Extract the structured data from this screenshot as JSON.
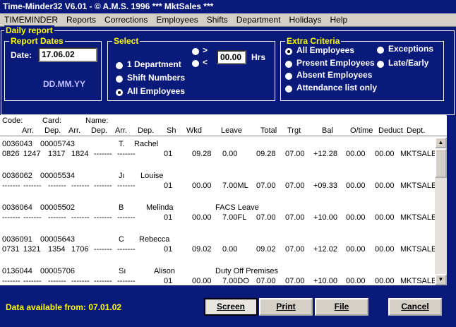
{
  "window": {
    "title": "Time-Minder32 V6.01 - © A.M.S. 1996   *** MktSales ***"
  },
  "menu": [
    "TIMEMINDER",
    "Reports",
    "Corrections",
    "Employees",
    "Shifts",
    "Department",
    "Holidays",
    "Help"
  ],
  "daily_report": {
    "label": "Daily report"
  },
  "report_dates": {
    "label": "Report Dates",
    "date_label": "Date:",
    "date_value": "17.06.02",
    "format_hint": "DD.MM.YY"
  },
  "select": {
    "label": "Select",
    "options": [
      "1 Department",
      "Shift Numbers",
      "All Employees"
    ],
    "selected": "All Employees",
    "compare_gt": ">",
    "compare_lt": "<",
    "hours_value": "00.00",
    "hours_unit": "Hrs"
  },
  "extra": {
    "label": "Extra Criteria",
    "options": [
      "All Employees",
      "Present Employees",
      "Absent Employees",
      "Attendance list only",
      "Exceptions",
      "Late/Early"
    ],
    "selected": "All Employees"
  },
  "columns": {
    "line1": [
      "Code:",
      "Card:",
      "Name:"
    ],
    "line2": [
      "Arr.",
      "Dep.",
      "Arr.",
      "Dep.",
      "Arr.",
      "Dep.",
      "Sh",
      "Wkd",
      "Leave",
      "Total",
      "Trgt",
      "Bal",
      "O/time",
      "Deduct",
      "Dept."
    ]
  },
  "rows": [
    {
      "code": "0036043",
      "card": "00005743",
      "initial": "T.",
      "name": "Rachel",
      "note": "",
      "times": [
        "0826",
        "1247",
        "1317",
        "1824",
        "-------",
        "-------"
      ],
      "sh": "01",
      "wkd": "09.28",
      "leave": "0.00",
      "total": "09.28",
      "trgt": "07.00",
      "bal": "+12.28",
      "otime": "00.00",
      "deduct": "00.00",
      "dept": "MKTSALE"
    },
    {
      "code": "0036062",
      "card": "00005534",
      "initial": "Jı",
      "name": "Louise",
      "note": "",
      "times": [
        "-------",
        "-------",
        "-------",
        "-------",
        "-------",
        "-------"
      ],
      "sh": "01",
      "wkd": "00.00",
      "leave": "7.00ML",
      "total": "07.00",
      "trgt": "07.00",
      "bal": "+09.33",
      "otime": "00.00",
      "deduct": "00.00",
      "dept": "MKTSALE"
    },
    {
      "code": "0036064",
      "card": "00005502",
      "initial": "B",
      "name": "Melinda",
      "note": "FACS Leave",
      "times": [
        "-------",
        "-------",
        "-------",
        "-------",
        "-------",
        "-------"
      ],
      "sh": "01",
      "wkd": "00.00",
      "leave": "7.00FL",
      "total": "07.00",
      "trgt": "07.00",
      "bal": "+10.00",
      "otime": "00.00",
      "deduct": "00.00",
      "dept": "MKTSALE"
    },
    {
      "code": "0036091",
      "card": "00005643",
      "initial": "C",
      "name": "Rebecca",
      "note": "",
      "times": [
        "0731",
        "1321",
        "1354",
        "1706",
        "-------",
        "-------"
      ],
      "sh": "01",
      "wkd": "09.02",
      "leave": "0.00",
      "total": "09.02",
      "trgt": "07.00",
      "bal": "+12.02",
      "otime": "00.00",
      "deduct": "00.00",
      "dept": "MKTSALE"
    },
    {
      "code": "0136044",
      "card": "00005706",
      "initial": "Sı",
      "name": "Alison",
      "note": "Duty Off Premises",
      "times": [
        "-------",
        "-------",
        "-------",
        "-------",
        "-------",
        "-------"
      ],
      "sh": "01",
      "wkd": "00.00",
      "leave": "7.00DO",
      "total": "07.00",
      "trgt": "07.00",
      "bal": "+10.00",
      "otime": "00.00",
      "deduct": "00.00",
      "dept": "MKTSALE"
    }
  ],
  "scroll": {
    "up_icon": "▲",
    "down_icon": "▼"
  },
  "footer": {
    "available_text": "Data available from:  07.01.02",
    "buttons": {
      "screen": "Screen",
      "print": "Print",
      "file": "File",
      "cancel": "Cancel"
    }
  },
  "colors": {
    "background": "#0a1a7a",
    "accent": "#ffff00",
    "button": "#d4d0c8"
  }
}
